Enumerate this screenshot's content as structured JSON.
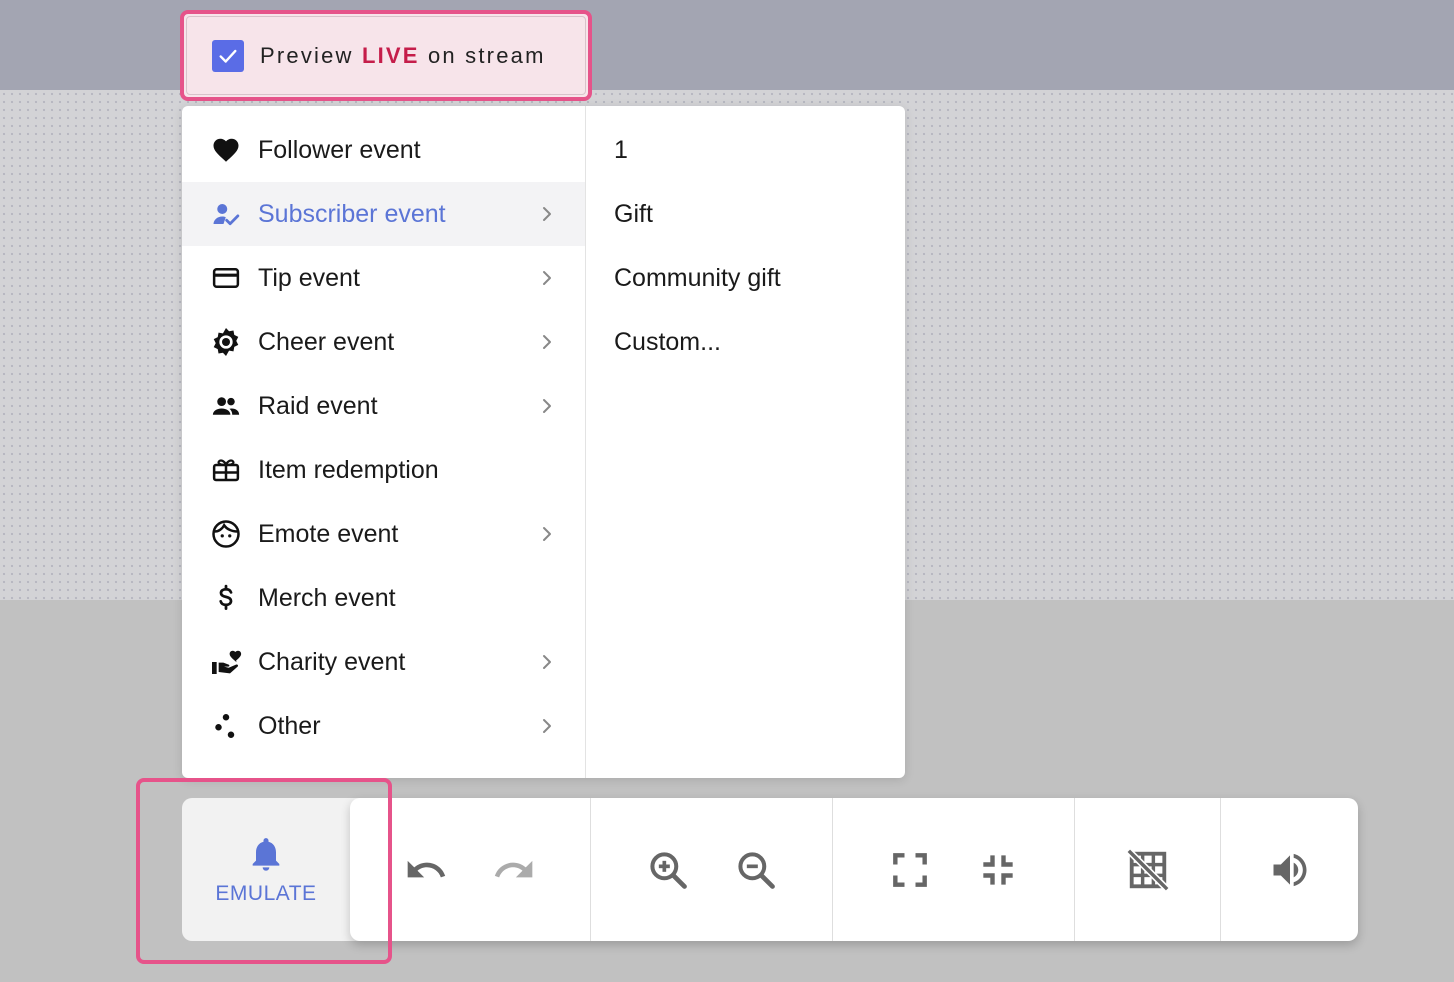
{
  "preview": {
    "checked": true,
    "label_before": "Preview ",
    "label_live": "LIVE",
    "label_after": " on stream"
  },
  "menu": {
    "items": [
      {
        "label": "Follower event",
        "icon": "heart-icon",
        "has_submenu": false
      },
      {
        "label": "Subscriber event",
        "icon": "person-check-icon",
        "has_submenu": true,
        "active": true
      },
      {
        "label": "Tip event",
        "icon": "credit-card-icon",
        "has_submenu": true
      },
      {
        "label": "Cheer event",
        "icon": "gear-burst-icon",
        "has_submenu": true
      },
      {
        "label": "Raid event",
        "icon": "group-icon",
        "has_submenu": true
      },
      {
        "label": "Item redemption",
        "icon": "gift-box-icon",
        "has_submenu": false
      },
      {
        "label": "Emote event",
        "icon": "face-icon",
        "has_submenu": true
      },
      {
        "label": "Merch event",
        "icon": "dollar-icon",
        "has_submenu": false
      },
      {
        "label": "Charity event",
        "icon": "hand-heart-icon",
        "has_submenu": true
      },
      {
        "label": "Other",
        "icon": "dots-icon",
        "has_submenu": true
      }
    ],
    "submenu": [
      "1",
      "Gift",
      "Community gift",
      "Custom..."
    ]
  },
  "emulate": {
    "label": "EMULATE",
    "icon": "bell-icon"
  },
  "toolbar": {
    "groups": [
      [
        "undo-icon",
        "redo-icon"
      ],
      [
        "zoom-in-icon",
        "zoom-out-icon"
      ],
      [
        "fullscreen-icon",
        "exit-fullscreen-icon"
      ],
      [
        "grid-off-icon"
      ],
      [
        "volume-icon"
      ]
    ]
  },
  "colors": {
    "accent": "#5b75d6",
    "highlight_border": "#e6538a",
    "live": "#c51d4a",
    "checkbox": "#5a6ce6"
  }
}
